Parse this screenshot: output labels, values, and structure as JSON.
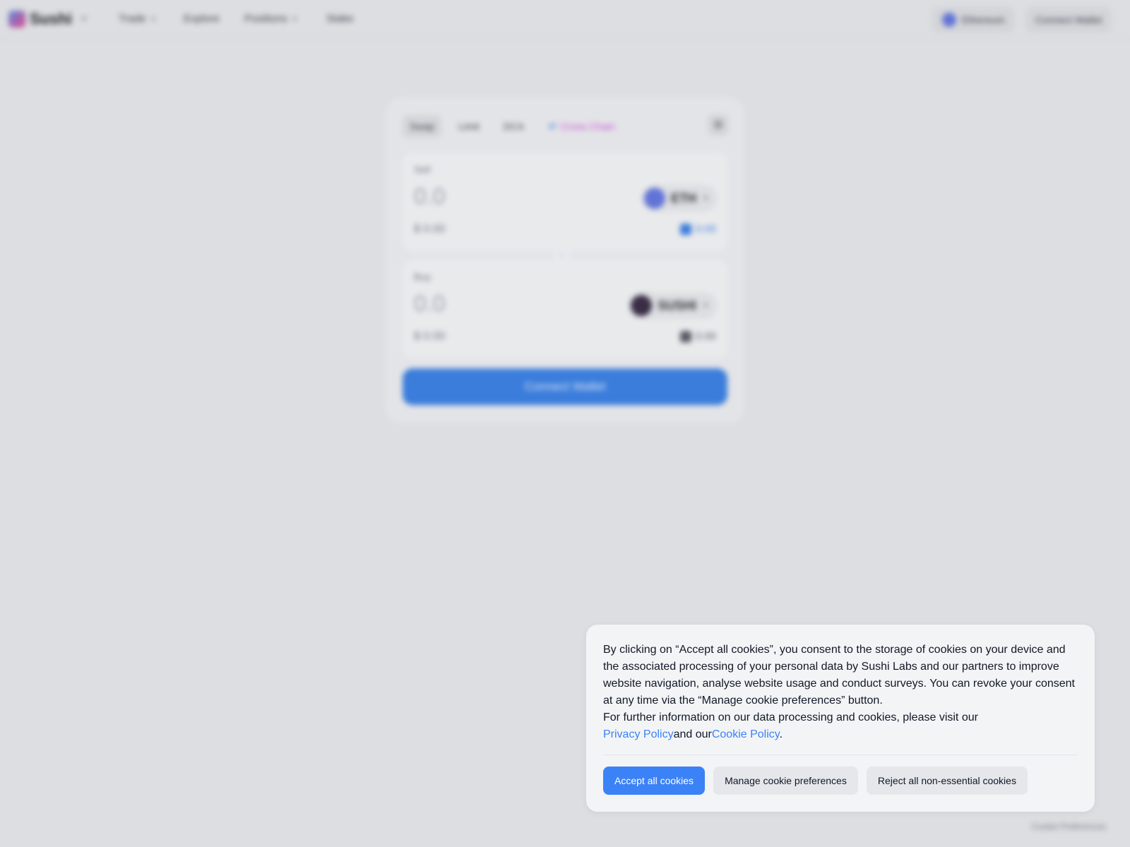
{
  "nav": {
    "brand": "Sushi",
    "links": [
      {
        "label": "Trade"
      },
      {
        "label": "Explore"
      },
      {
        "label": "Positions"
      },
      {
        "label": "Stake"
      }
    ],
    "network_label": "Ethereum",
    "connect_label": "Connect Wallet"
  },
  "swap": {
    "tabs": [
      "Swap",
      "Limit",
      "DCA",
      "Cross Chain"
    ],
    "sell": {
      "label": "Sell",
      "amount": "0.0",
      "usd": "$ 0.00",
      "token": "ETH",
      "balance": "0.00",
      "token_color": "#6173d6",
      "balance_color": "#3b7ddb"
    },
    "buy": {
      "label": "Buy",
      "amount": "0.0",
      "usd": "$ 0.00",
      "token": "SUSHI",
      "balance": "0.00",
      "token_color": "#3a2d45",
      "balance_color": "#555a62"
    },
    "cta_label": "Connect Wallet"
  },
  "footer": {
    "cookie_prefs": "Cookie Preferences"
  },
  "cookie_banner": {
    "paragraph_1": "By clicking on “Accept all cookies”, you consent to the storage of cookies on your device and the associated processing of your personal data by Sushi Labs and our partners to improve website navigation, analyse website usage and conduct surveys. You can revoke your consent at any time via the “Manage cookie preferences” button.",
    "paragraph_2": "For further information on our data processing and cookies, please visit our",
    "privacy_link": "Privacy Policy",
    "and_text": "and our",
    "cookie_link": "Cookie Policy",
    "period": ".",
    "accept_label": "Accept all cookies",
    "manage_label": "Manage cookie preferences",
    "reject_label": "Reject all non-essential cookies",
    "accent_color": "#3b82f6"
  }
}
